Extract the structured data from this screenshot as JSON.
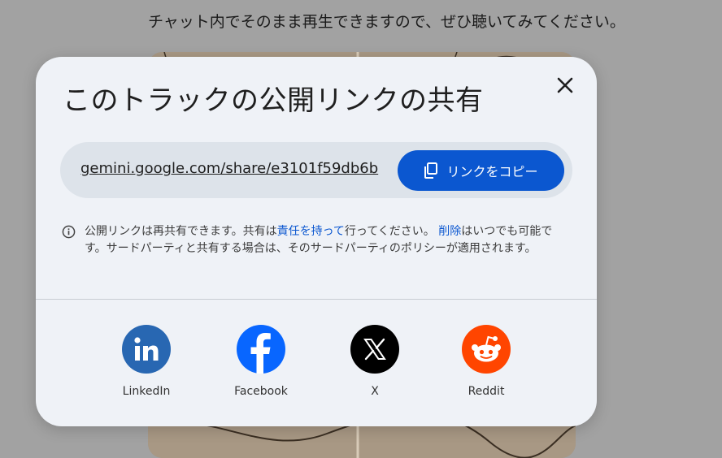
{
  "background": {
    "text": "チャット内でそのまま再生できますので、ぜひ聴いてみてください。"
  },
  "dialog": {
    "title": "このトラックの公開リンクの共有",
    "link": {
      "url": "gemini.google.com/share/e3101f59db6b",
      "copy_label": "リンクをコピー"
    },
    "notice": {
      "part1": "公開リンクは再共有できます。共有は",
      "link1": "責任を持って",
      "part2": "行ってください。 ",
      "link2": "削除",
      "part3": "はいつでも可能です。サードパーティと共有する場合は、そのサードパーティのポリシーが適用されます。"
    },
    "share": [
      {
        "name": "LinkedIn",
        "icon": "linkedin-icon",
        "color": "#2867b2"
      },
      {
        "name": "Facebook",
        "icon": "facebook-icon",
        "color": "#0866ff"
      },
      {
        "name": "X",
        "icon": "x-icon",
        "color": "#000000"
      },
      {
        "name": "Reddit",
        "icon": "reddit-icon",
        "color": "#ff4500"
      }
    ]
  },
  "colors": {
    "primary": "#0b57d0",
    "dialog_bg": "#eff2f7",
    "link_box_bg": "#dde3ea",
    "overlay": "#a2a2a2"
  }
}
